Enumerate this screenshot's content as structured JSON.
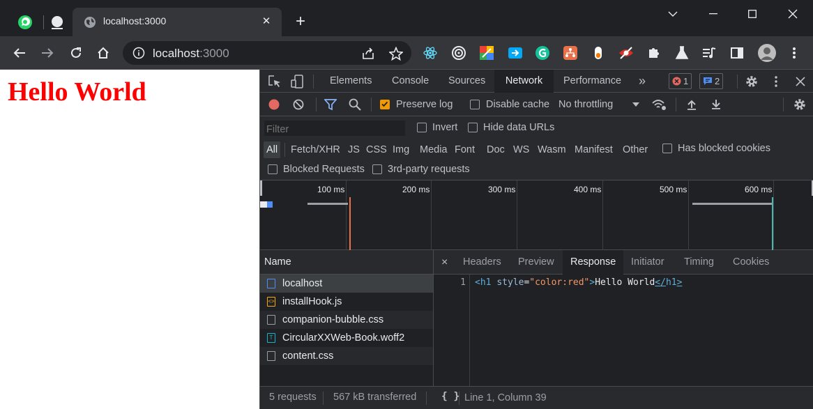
{
  "browser": {
    "tab_title": "localhost:3000",
    "url_host": "localhost",
    "url_port": ":3000",
    "icons": [
      "whatsapp-icon",
      "pinned-tab-icon",
      "globe-icon",
      "close-icon",
      "new-tab-icon",
      "minimize-icon",
      "maximize-icon",
      "chevron-down-icon",
      "back-icon",
      "forward-icon",
      "reload-icon",
      "home-icon",
      "info-icon",
      "share-icon",
      "star-icon"
    ],
    "extensions": [
      "react-icon",
      "target-icon",
      "colorful-extension-icon",
      "arrow-extension-icon",
      "grammarly-icon",
      "network-extension-icon",
      "toggle-extension-icon",
      "eye-slash-icon",
      "puzzle-icon",
      "flask-icon",
      "media-icon",
      "sidebar-icon",
      "avatar",
      "menu-icon"
    ]
  },
  "page": {
    "heading": "Hello World",
    "heading_color": "#ff0000"
  },
  "devtools": {
    "tabs": [
      "Elements",
      "Console",
      "Sources",
      "Network",
      "Performance"
    ],
    "active_tab": "Network",
    "more_tabs": "»",
    "error_count": "1",
    "message_count": "2",
    "network_toolbar": {
      "preserve_log": "Preserve log",
      "preserve_log_checked": true,
      "disable_cache": "Disable cache",
      "throttling": "No throttling"
    },
    "filter": {
      "placeholder": "Filter",
      "invert": "Invert",
      "hide_data_urls": "Hide data URLs",
      "types": [
        "All",
        "Fetch/XHR",
        "JS",
        "CSS",
        "Img",
        "Media",
        "Font",
        "Doc",
        "WS",
        "Wasm",
        "Manifest",
        "Other"
      ],
      "has_blocked_cookies": "Has blocked cookies",
      "blocked_requests": "Blocked Requests",
      "third_party": "3rd-party requests"
    },
    "timeline_ticks": [
      "100 ms",
      "200 ms",
      "300 ms",
      "400 ms",
      "500 ms",
      "600 ms"
    ],
    "requests": {
      "header": "Name",
      "items": [
        {
          "name": "localhost",
          "icon": "document-icon",
          "color": "#4e8ef7"
        },
        {
          "name": "installHook.js",
          "icon": "script-icon",
          "color": "#f9ab00"
        },
        {
          "name": "companion-bubble.css",
          "icon": "file-icon",
          "color": "#9aa0a6"
        },
        {
          "name": "CircularXXWeb-Book.woff2",
          "icon": "font-icon",
          "color": "#12b5cb"
        },
        {
          "name": "content.css",
          "icon": "file-icon",
          "color": "#9aa0a6"
        }
      ],
      "summary_requests": "5 requests",
      "summary_transferred": "567 kB transferred"
    },
    "detail": {
      "close": "×",
      "tabs": [
        "Headers",
        "Preview",
        "Response",
        "Initiator",
        "Timing",
        "Cookies"
      ],
      "active_tab": "Response",
      "line_number": "1",
      "code": {
        "open_tag_start": "<h1",
        "attr_name": "style",
        "attr_eq": "=",
        "attr_value": "\"color:red\"",
        "tag_close": ">",
        "text": "Hello World",
        "close_tag_start": "</",
        "close_tag_name": "h1",
        "close_tag_end": ">"
      },
      "pretty_print": "{ }",
      "cursor_position": "Line 1, Column 39"
    }
  }
}
